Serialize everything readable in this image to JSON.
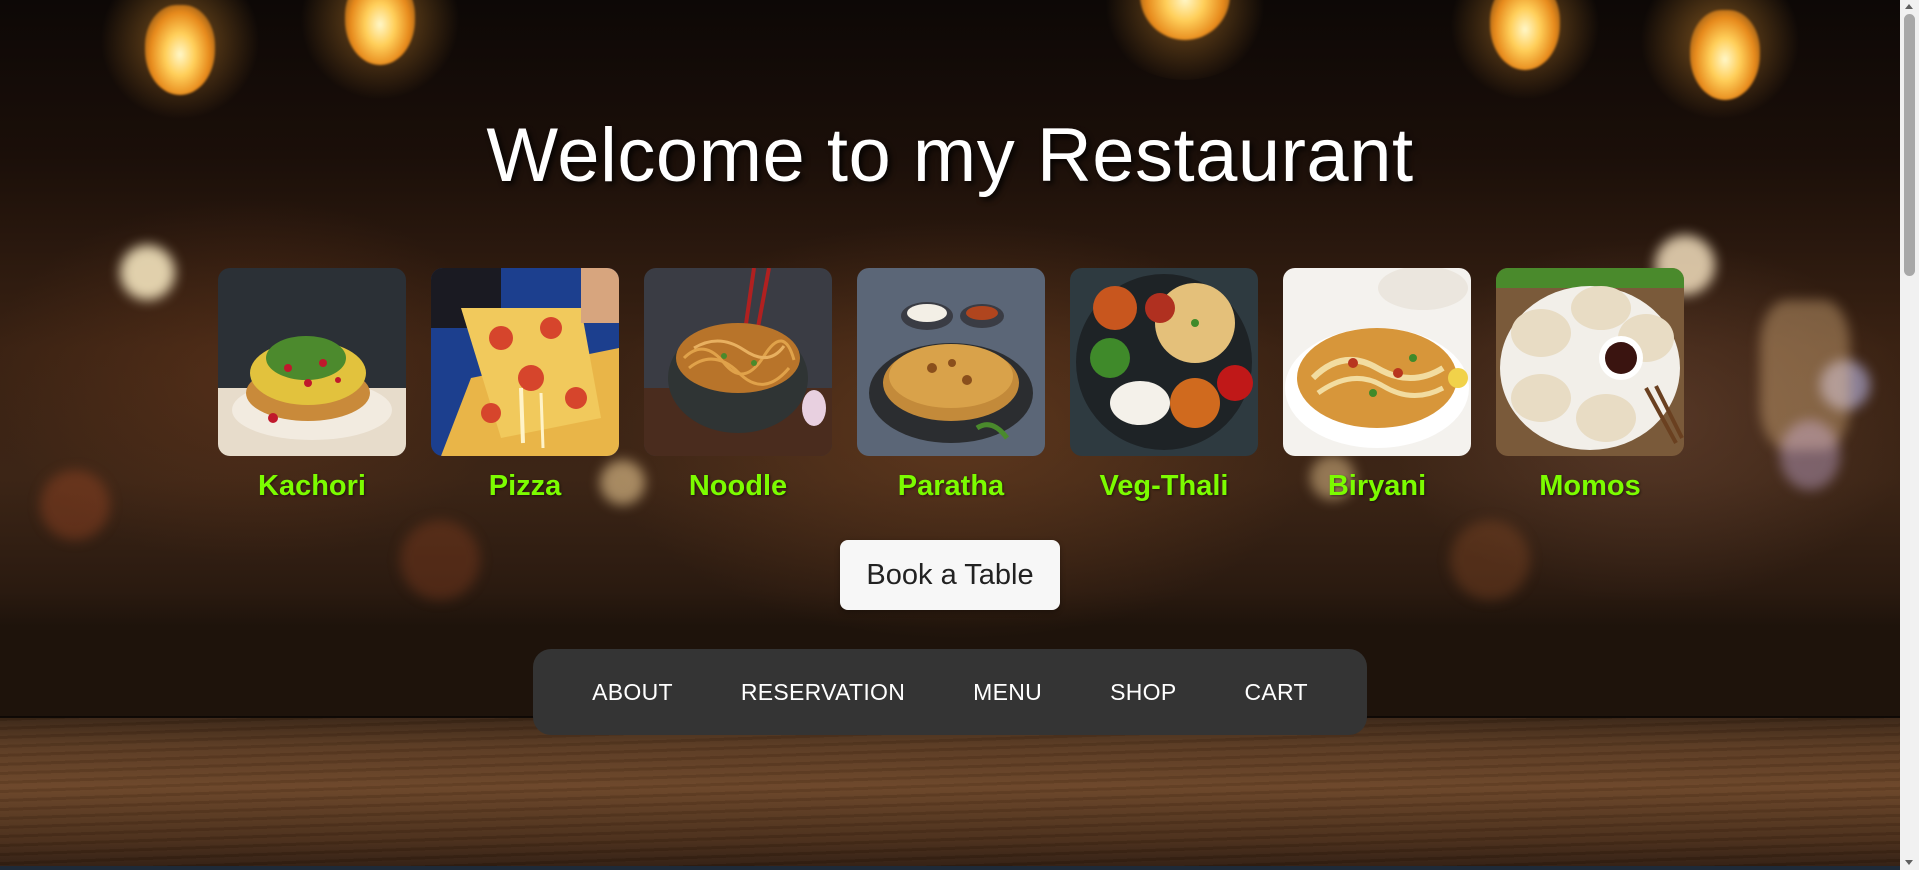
{
  "page": {
    "title": "Welcome to my Restaurant"
  },
  "foods": [
    {
      "label": "Kachori",
      "icon": "kachori-image"
    },
    {
      "label": "Pizza",
      "icon": "pizza-image"
    },
    {
      "label": "Noodle",
      "icon": "noodle-image"
    },
    {
      "label": "Paratha",
      "icon": "paratha-image"
    },
    {
      "label": "Veg-Thali",
      "icon": "veg-thali-image"
    },
    {
      "label": "Biryani",
      "icon": "biryani-image"
    },
    {
      "label": "Momos",
      "icon": "momos-image"
    }
  ],
  "book_button": {
    "label": "Book a Table"
  },
  "nav": {
    "items": [
      {
        "label": "ABOUT"
      },
      {
        "label": "RESERVATION"
      },
      {
        "label": "MENU"
      },
      {
        "label": "SHOP"
      },
      {
        "label": "CART"
      }
    ]
  },
  "colors": {
    "food_label": "#7cfc00",
    "nav_bg": "#343434",
    "title": "#ffffff",
    "button_bg": "#f7f7f7"
  }
}
